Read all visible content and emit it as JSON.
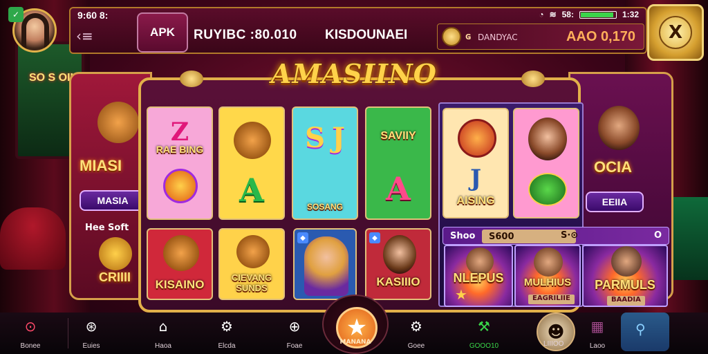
{
  "status_bar": {
    "time": "9:60 8:",
    "signal": "58:",
    "battery_label": "1:32",
    "battery_level": 0.9
  },
  "top_bar": {
    "apk_label": "APK",
    "balance_text": "RUYIBC :80.010",
    "tournament_text": "KISDOUNAEI",
    "wallet_currency": "ɢ",
    "wallet_label": "DANDYAC",
    "wallet_amount": "AAO 0,170",
    "close_symbol": "X"
  },
  "main": {
    "logo": "AMASIINO",
    "left_panel": {
      "title": "MIASI",
      "tag": "MASIA",
      "small": "Hee Soft",
      "bottom": "CRIIII"
    },
    "right_panel": {
      "title": "OCIA",
      "tag": "EEIIA",
      "hero_title": "PARMULS",
      "hero_chip": "BAADIA"
    },
    "tiles": [
      {
        "text": "RAE BING",
        "glyph": "Z",
        "bg": "#f7a8d8"
      },
      {
        "text": "A",
        "glyph": "",
        "bg": "#ffd84a"
      },
      {
        "text": "SOSANG",
        "glyph": "S J",
        "bg": "#5ad8e0"
      },
      {
        "text": "SAVIIY",
        "glyph": "A",
        "bg": "#3ab84a"
      },
      {
        "text": "AISING",
        "glyph": "J",
        "bg": "#ffe6b0"
      },
      {
        "text": "",
        "glyph": "",
        "bg": "#ff9ad0"
      },
      {
        "text": "KISAINO",
        "glyph": "",
        "bg": "#d0283a"
      },
      {
        "text": "CIEVANG SUNDS",
        "glyph": "",
        "bg": "#ffd24a"
      },
      {
        "text": "",
        "glyph": "",
        "bg": "#2a5ab0"
      },
      {
        "text": "KASIIIO",
        "glyph": "",
        "bg": "#c02a3a"
      }
    ],
    "promo": {
      "label": "Shoo",
      "value": "S600",
      "suffix": "S·⊙",
      "end": "O"
    },
    "heroes": [
      {
        "title": "NLEPUS",
        "chip": ""
      },
      {
        "title": "MULHIUS",
        "chip": "EAGRILIIE"
      }
    ]
  },
  "bottom_nav": {
    "items": [
      {
        "label": "Bonee",
        "icon": "⊙"
      },
      {
        "label": "Euies",
        "icon": "⊛"
      },
      {
        "label": "Haoa",
        "icon": "⌂"
      },
      {
        "label": "Elcda",
        "icon": "⚙"
      },
      {
        "label": "Foae",
        "icon": "⊕"
      },
      {
        "label": "Goee",
        "icon": "⚙"
      },
      {
        "label": "GOOO10",
        "icon": "⚒"
      },
      {
        "label": "Laoo",
        "icon": "▦"
      }
    ],
    "center_label": "MANANA",
    "mask_label": "LIIIOO"
  }
}
